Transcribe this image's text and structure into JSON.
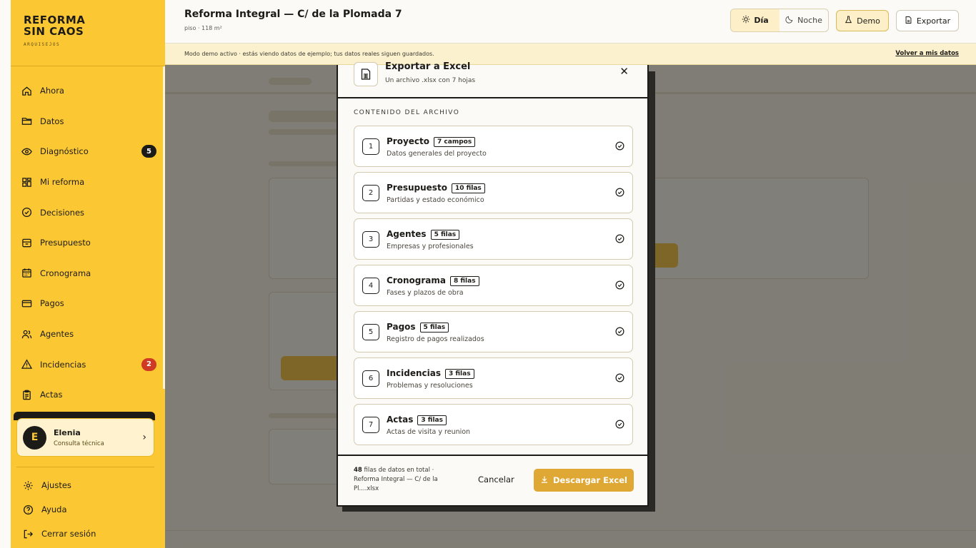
{
  "brand": {
    "line1": "REFORMA",
    "line2": "SIN CAOS",
    "tagline": "ARQUISEJOS"
  },
  "sidebar": {
    "items": [
      {
        "label": "Ahora",
        "icon": "home-icon"
      },
      {
        "label": "Datos",
        "icon": "folder-icon"
      },
      {
        "label": "Diagnóstico",
        "icon": "eye-icon",
        "badge": "5"
      },
      {
        "label": "Mi reforma",
        "icon": "grid-icon"
      },
      {
        "label": "Decisiones",
        "icon": "check-circle-icon"
      },
      {
        "label": "Presupuesto",
        "icon": "wallet-icon"
      },
      {
        "label": "Cronograma",
        "icon": "calendar-icon"
      },
      {
        "label": "Pagos",
        "icon": "credit-card-icon"
      },
      {
        "label": "Agentes",
        "icon": "users-icon"
      },
      {
        "label": "Incidencias",
        "icon": "warning-icon",
        "badge": "2"
      },
      {
        "label": "Actas",
        "icon": "clipboard-icon"
      }
    ],
    "user": {
      "initial": "E",
      "name": "Elenia",
      "role": "Consulta técnica"
    },
    "bottom": [
      {
        "label": "Ajustes",
        "icon": "gear-icon"
      },
      {
        "label": "Ayuda",
        "icon": "help-icon"
      },
      {
        "label": "Cerrar sesión",
        "icon": "logout-icon"
      }
    ]
  },
  "header": {
    "title": "Reforma Integral — C/ de la Plomada 7",
    "subtitle": "piso · 118 m²",
    "theme_day": "Día",
    "theme_night": "Noche",
    "demo_label": "Demo",
    "export_label": "Exportar"
  },
  "demo_bar": {
    "text": "Modo demo activo · estás viendo datos de ejemplo; tus datos reales siguen guardados.",
    "link": "Volver a mis datos"
  },
  "modal": {
    "title": "Exportar a Excel",
    "subtitle": "Un archivo .xlsx con 7 hojas",
    "section_label": "CONTENIDO DEL ARCHIVO",
    "sheets": [
      {
        "num": "1",
        "name": "Proyecto",
        "count": "7 campos",
        "desc": "Datos generales del proyecto"
      },
      {
        "num": "2",
        "name": "Presupuesto",
        "count": "10 filas",
        "desc": "Partidas y estado económico"
      },
      {
        "num": "3",
        "name": "Agentes",
        "count": "5 filas",
        "desc": "Empresas y profesionales"
      },
      {
        "num": "4",
        "name": "Cronograma",
        "count": "8 filas",
        "desc": "Fases y plazos de obra"
      },
      {
        "num": "5",
        "name": "Pagos",
        "count": "5 filas",
        "desc": "Registro de pagos realizados"
      },
      {
        "num": "6",
        "name": "Incidencias",
        "count": "3 filas",
        "desc": "Problemas y resoluciones"
      },
      {
        "num": "7",
        "name": "Actas",
        "count": "3 filas",
        "desc": "Actas de visita y reunion"
      }
    ],
    "footer": {
      "rows_total": "48",
      "rows_text": "filas de datos en total ·",
      "filename": "Reforma Integral — C/ de la Pl....xlsx",
      "cancel": "Cancelar",
      "download": "Descargar Excel"
    }
  },
  "colors": {
    "sidebar": "#fbc834",
    "accent": "#dfa733",
    "badge_red": "#cf3a24",
    "ink": "#1d1b17"
  }
}
